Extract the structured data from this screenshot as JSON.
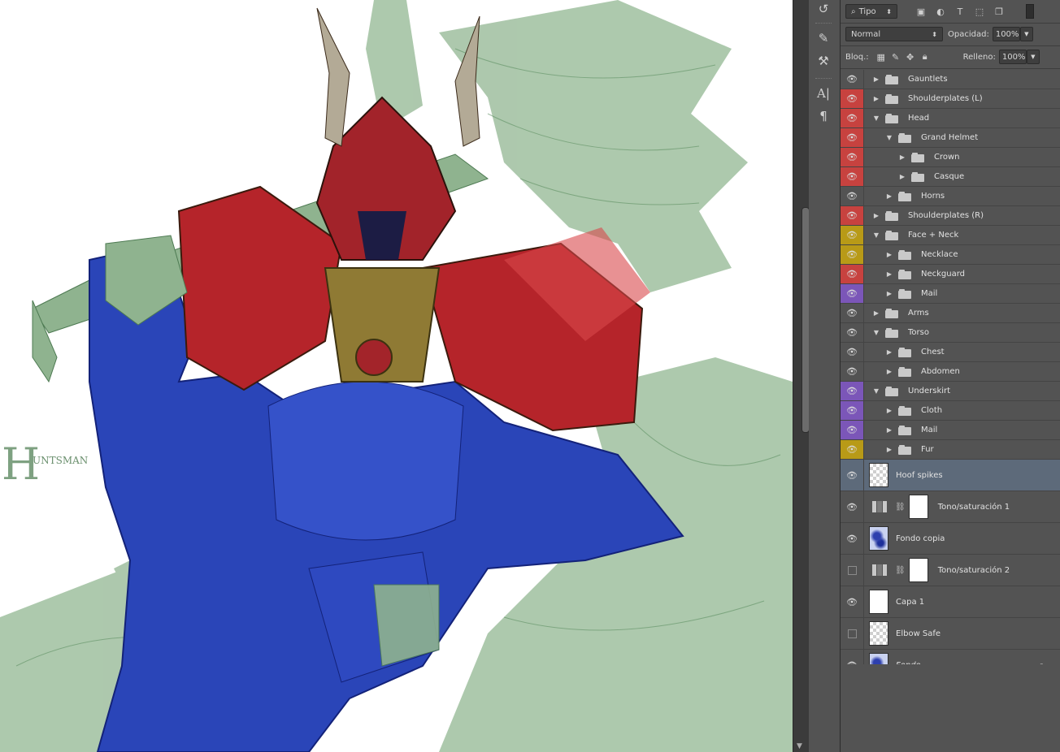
{
  "options_bar": {
    "filter_label": "Tipo",
    "blend_mode": "Normal",
    "opacity_label": "Opacidad:",
    "opacity_value": "100%",
    "lock_label": "Bloq.:",
    "fill_label": "Relleno:",
    "fill_value": "100%"
  },
  "canvas": {
    "signature_text": "UNTSMAN",
    "signature_letter": "H"
  },
  "colors": {
    "red": "#c7423f",
    "yellow": "#b89a17",
    "violet": "#7b56b8",
    "none": "#535353",
    "selected": "#5d6a7a"
  },
  "layers": [
    {
      "name": "Gauntlets",
      "type": "group",
      "depth": 0,
      "expanded": false,
      "visible": true,
      "color": "none"
    },
    {
      "name": "Shoulderplates (L)",
      "type": "group",
      "depth": 0,
      "expanded": false,
      "visible": true,
      "color": "red"
    },
    {
      "name": "Head",
      "type": "group",
      "depth": 0,
      "expanded": true,
      "visible": true,
      "color": "red"
    },
    {
      "name": "Grand Helmet",
      "type": "group",
      "depth": 1,
      "expanded": true,
      "visible": true,
      "color": "red"
    },
    {
      "name": "Crown",
      "type": "group",
      "depth": 2,
      "expanded": false,
      "visible": true,
      "color": "red"
    },
    {
      "name": "Casque",
      "type": "group",
      "depth": 2,
      "expanded": false,
      "visible": true,
      "color": "red"
    },
    {
      "name": "Horns",
      "type": "group",
      "depth": 1,
      "expanded": false,
      "visible": true,
      "color": "none"
    },
    {
      "name": "Shoulderplates (R)",
      "type": "group",
      "depth": 0,
      "expanded": false,
      "visible": true,
      "color": "red"
    },
    {
      "name": "Face + Neck",
      "type": "group",
      "depth": 0,
      "expanded": true,
      "visible": true,
      "color": "yellow"
    },
    {
      "name": "Necklace",
      "type": "group",
      "depth": 1,
      "expanded": false,
      "visible": true,
      "color": "yellow"
    },
    {
      "name": "Neckguard",
      "type": "group",
      "depth": 1,
      "expanded": false,
      "visible": true,
      "color": "red"
    },
    {
      "name": "Mail",
      "type": "group",
      "depth": 1,
      "expanded": false,
      "visible": true,
      "color": "violet"
    },
    {
      "name": "Arms",
      "type": "group",
      "depth": 0,
      "expanded": false,
      "visible": true,
      "color": "none"
    },
    {
      "name": "Torso",
      "type": "group",
      "depth": 0,
      "expanded": true,
      "visible": true,
      "color": "none"
    },
    {
      "name": "Chest",
      "type": "group",
      "depth": 1,
      "expanded": false,
      "visible": true,
      "color": "none"
    },
    {
      "name": "Abdomen",
      "type": "group",
      "depth": 1,
      "expanded": false,
      "visible": true,
      "color": "none"
    },
    {
      "name": "Underskirt",
      "type": "group",
      "depth": 0,
      "expanded": true,
      "visible": true,
      "color": "violet"
    },
    {
      "name": "Cloth",
      "type": "group",
      "depth": 1,
      "expanded": false,
      "visible": true,
      "color": "violet"
    },
    {
      "name": "Mail",
      "type": "group",
      "depth": 1,
      "expanded": false,
      "visible": true,
      "color": "violet"
    },
    {
      "name": "Fur",
      "type": "group",
      "depth": 1,
      "expanded": false,
      "visible": true,
      "color": "yellow"
    },
    {
      "name": "Hoof spikes",
      "type": "pixel",
      "thumb": "checker",
      "visible": true,
      "selected": true
    },
    {
      "name": "Tono/saturación 1",
      "type": "adjustment",
      "visible": true
    },
    {
      "name": "Fondo copia",
      "type": "pixel",
      "thumb": "art",
      "visible": true
    },
    {
      "name": "Tono/saturación 2",
      "type": "adjustment",
      "visible": false
    },
    {
      "name": "Capa 1",
      "type": "pixel",
      "thumb": "white",
      "visible": true
    },
    {
      "name": "Elbow Safe",
      "type": "pixel",
      "thumb": "checker",
      "visible": false
    },
    {
      "name": "Fondo",
      "type": "pixel",
      "thumb": "art",
      "visible": true,
      "italic": true,
      "locked": true
    }
  ]
}
